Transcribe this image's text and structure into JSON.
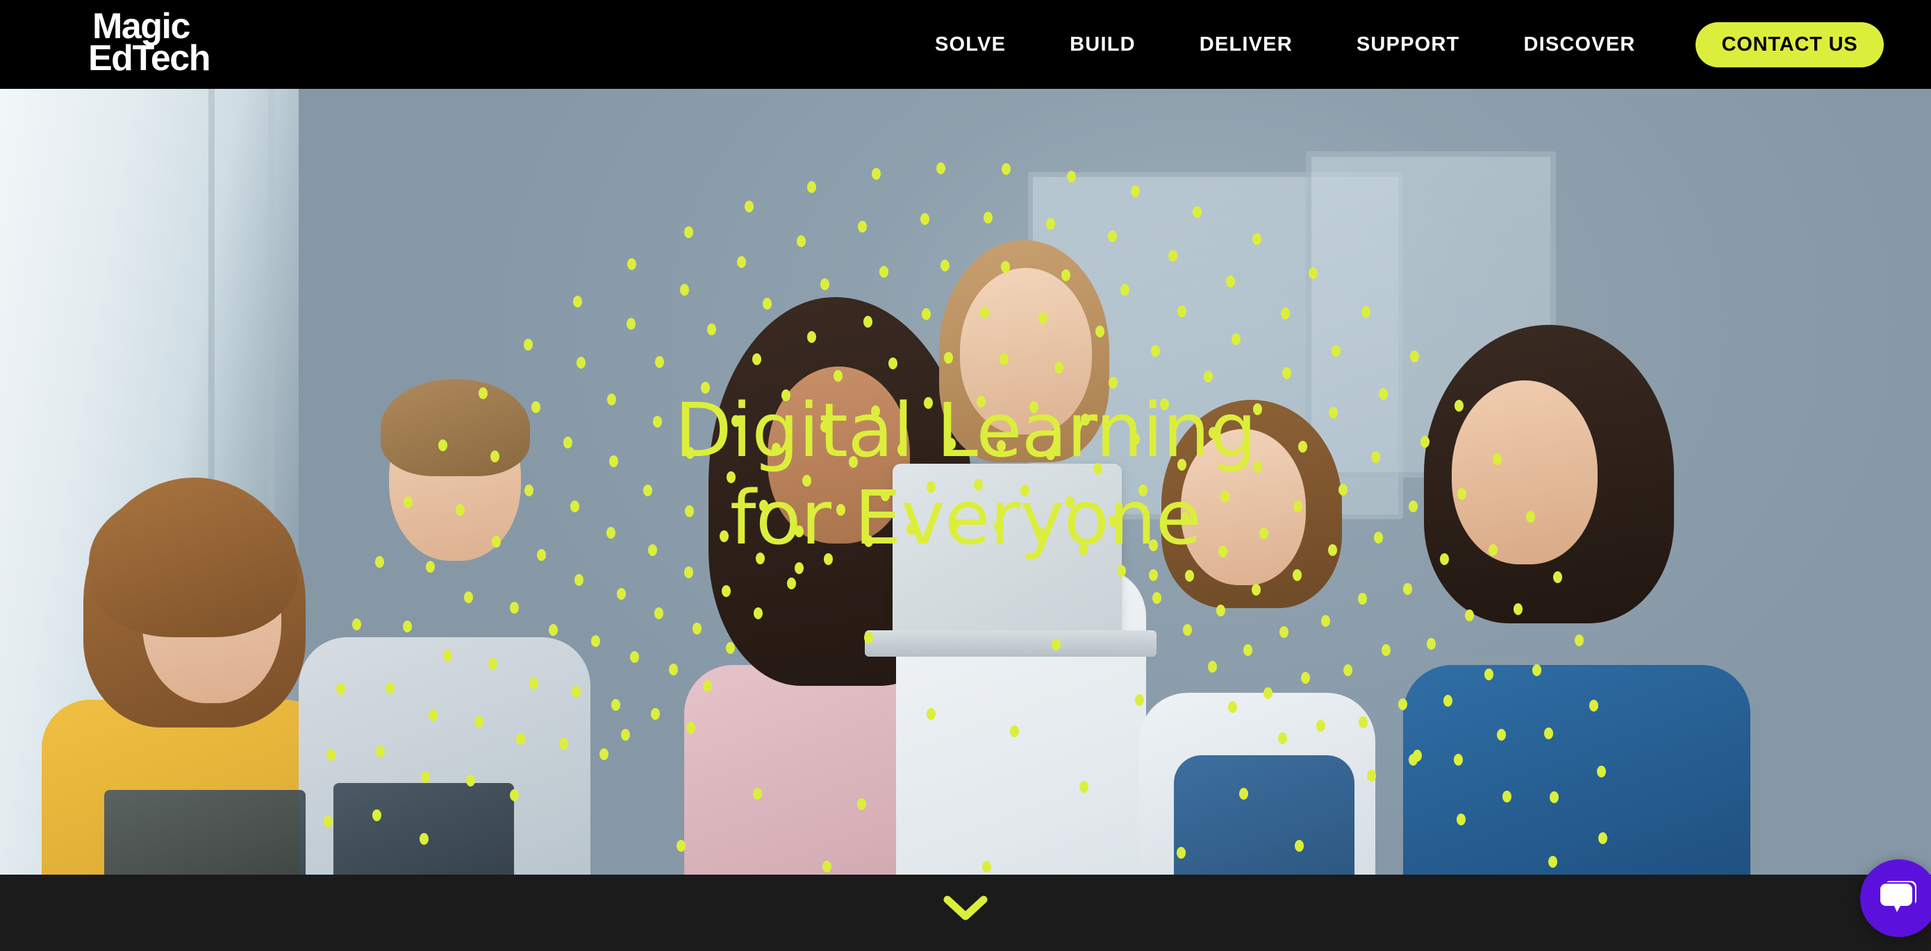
{
  "header": {
    "logo": {
      "line1": "Magic",
      "line2": "EdTech",
      "name": "Magic EdTech"
    },
    "nav": [
      {
        "label": "SOLVE"
      },
      {
        "label": "BUILD"
      },
      {
        "label": "DELIVER"
      },
      {
        "label": "SUPPORT"
      },
      {
        "label": "DISCOVER"
      }
    ],
    "cta": {
      "label": "CONTACT US"
    },
    "background_color": "#000000"
  },
  "hero": {
    "headline_line1": "Digital Learning",
    "headline_line2": "for Everyone",
    "headline_color": "#DCEE3C",
    "background_description": "Photo of six children gathered around a silver laptop in a bright classroom",
    "decoration": "arc of lime dots"
  },
  "footer": {
    "scroll_indicator": "chevron-down",
    "background_color": "#1B1B1B"
  },
  "widgets": {
    "chat": {
      "label": "chat-bubble",
      "color": "#5B11DB"
    }
  },
  "colors": {
    "accent_lime": "#DCEE3C",
    "black": "#000000",
    "dark_bar": "#1B1B1B",
    "chat_purple": "#5B11DB"
  }
}
